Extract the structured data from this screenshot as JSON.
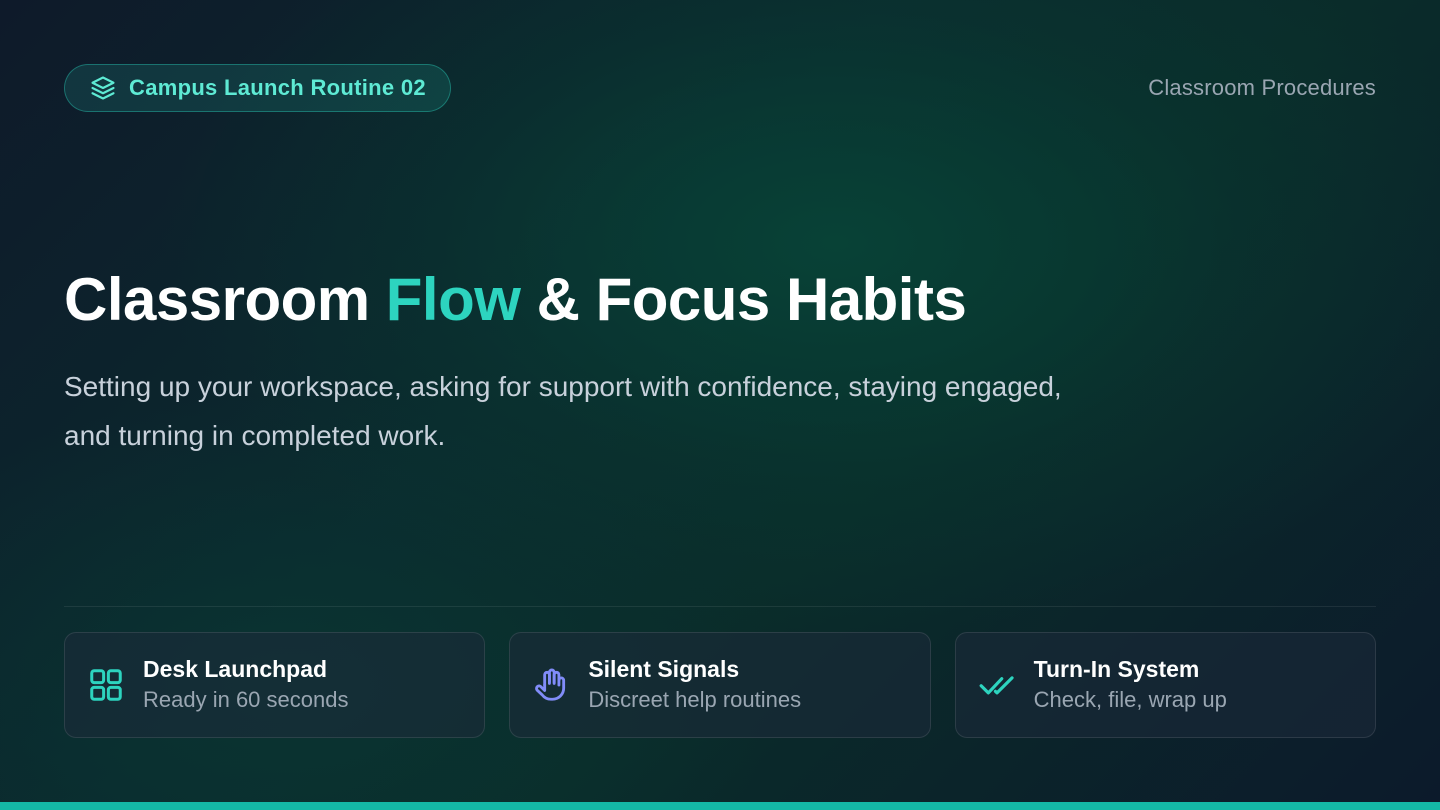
{
  "badge": {
    "label": "Campus Launch Routine 02",
    "icon": "layers-icon"
  },
  "header": {
    "topic": "Classroom Procedures"
  },
  "hero": {
    "title_before": "Classroom ",
    "title_accent": "Flow",
    "title_after": " & Focus Habits",
    "subtitle": "Setting up your workspace, asking for support with confidence, staying engaged, and turning in completed work."
  },
  "cards": [
    {
      "icon": "grid-icon",
      "title": "Desk Launchpad",
      "subtitle": "Ready in 60 seconds"
    },
    {
      "icon": "raised-hand-icon",
      "title": "Silent Signals",
      "subtitle": "Discreet help routines"
    },
    {
      "icon": "double-check-icon",
      "title": "Turn-In System",
      "subtitle": "Check, file, wrap up"
    }
  ],
  "colors": {
    "accent": "#2dd4bf",
    "accent_bar": "#14b8a6",
    "hand_icon": "#818cf8",
    "muted_text": "#9aa6b2"
  }
}
